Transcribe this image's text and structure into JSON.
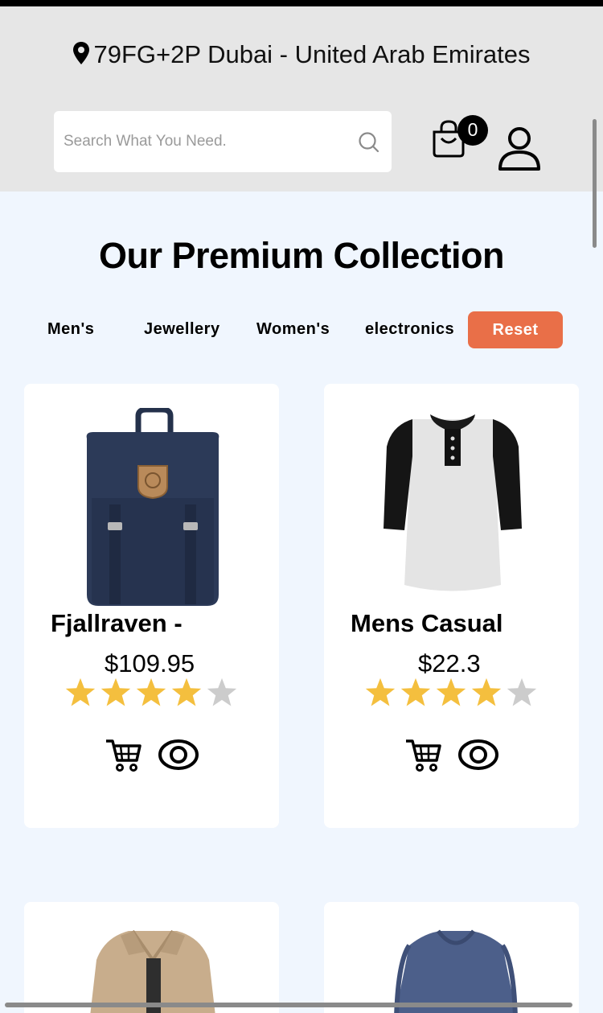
{
  "header": {
    "location": "79FG+2P Dubai - United Arab Emirates",
    "search_placeholder": "Search What You Need.",
    "cart_count": "0"
  },
  "section_title": "Our Premium Collection",
  "filters": [
    "Men's",
    "Jewellery",
    "Women's",
    "electronics"
  ],
  "reset_label": "Reset",
  "colors": {
    "accent": "#e96f48",
    "star_filled": "#f4bf3e",
    "star_empty": "#cccccc",
    "page_bg": "#f0f6fe",
    "header_bg": "#e6e6e6"
  },
  "products": [
    {
      "name": "Fjallraven -",
      "price": "$109.95",
      "rating": 4,
      "max_rating": 5
    },
    {
      "name": "Mens Casual",
      "price": "$22.3",
      "rating": 4,
      "max_rating": 5
    },
    {
      "name": "",
      "price": "",
      "rating": 0,
      "max_rating": 5
    },
    {
      "name": "",
      "price": "",
      "rating": 0,
      "max_rating": 5
    }
  ],
  "icons": [
    "location-pin-icon",
    "search-icon",
    "shopping-bag-icon",
    "user-icon",
    "cart-icon",
    "eye-icon",
    "star-icon"
  ]
}
